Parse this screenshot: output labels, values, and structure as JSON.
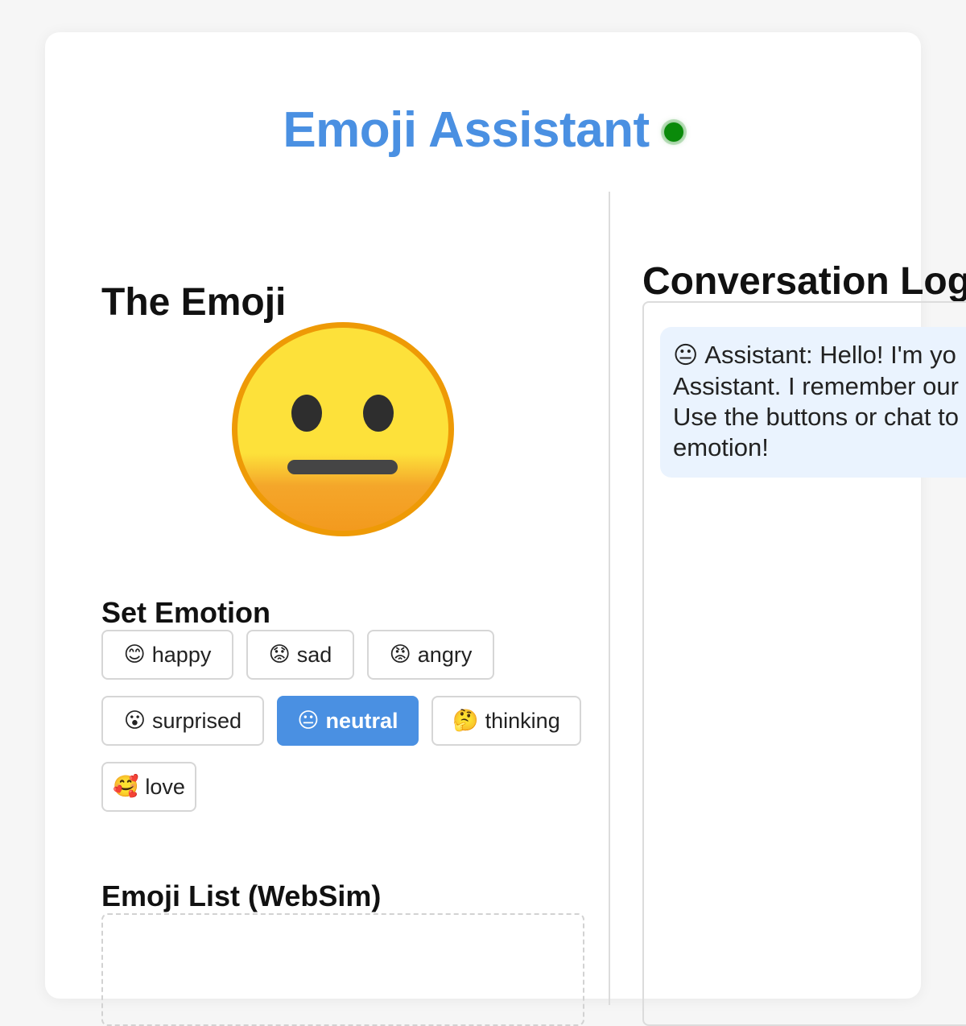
{
  "header": {
    "title": "Emoji Assistant",
    "status_color": "#0a8a0a"
  },
  "left": {
    "emoji_heading": "The Emoji",
    "current_emotion": "neutral",
    "set_emotion_heading": "Set Emotion",
    "buttons": [
      {
        "emoji": "😊",
        "label": "happy"
      },
      {
        "emoji": "😟",
        "label": "sad"
      },
      {
        "emoji": "😡",
        "label": "angry"
      },
      {
        "emoji": "😮",
        "label": "surprised"
      },
      {
        "emoji": "😐",
        "label": "neutral"
      },
      {
        "emoji": "🤔",
        "label": "thinking"
      },
      {
        "emoji": "🥰",
        "label": "love"
      }
    ],
    "emoji_list_heading": "Emoji List (WebSim)"
  },
  "right": {
    "log_heading": "Conversation Log",
    "messages": [
      {
        "emoji": "😐",
        "lines": [
          "Assistant: Hello! I'm yo",
          "Assistant. I remember our",
          "Use the buttons or chat to",
          "emotion!"
        ]
      }
    ]
  },
  "colors": {
    "accent": "#4a90e2",
    "message_bg": "#eaf3fe"
  }
}
